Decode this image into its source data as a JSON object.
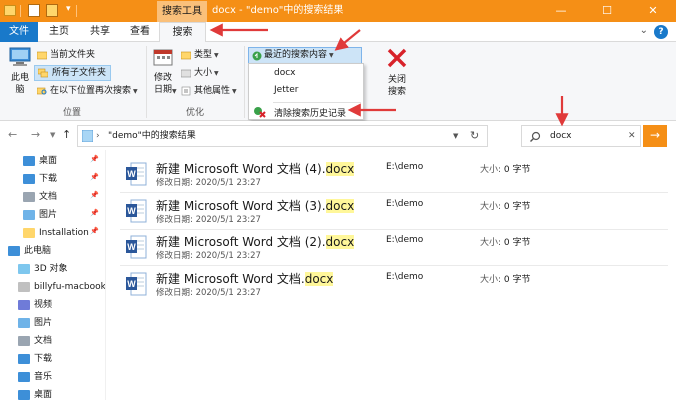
{
  "titlebar": {
    "context_tab_header": "搜索工具",
    "window_title": "docx - \"demo\"中的搜索结果",
    "minimize": "—",
    "maximize": "☐",
    "close": "✕"
  },
  "tabs": {
    "file": "文件",
    "home": "主页",
    "share": "共享",
    "view": "查看",
    "search": "搜索"
  },
  "ribbon": {
    "location_group": {
      "label": "位置",
      "this_pc": "此电\n脑",
      "current_folder": "当前文件夹",
      "all_subfolders": "所有子文件夹",
      "search_again_in": "在以下位置再次搜索"
    },
    "refine_group": {
      "label": "优化",
      "date_modified": "修改\n日期",
      "kind": "类型",
      "size": "大小",
      "other_properties": "其他属性"
    },
    "recent_searches": "最近的搜索内容",
    "recent_items": [
      "docx",
      "Jetter"
    ],
    "clear_history": "清除搜索历史记录",
    "close_search": "关闭\n搜索"
  },
  "address": {
    "path": "\"demo\"中的搜索结果"
  },
  "search": {
    "query": "docx",
    "clear": "✕",
    "go": "→"
  },
  "nav": {
    "items": [
      {
        "label": "桌面",
        "pinned": true
      },
      {
        "label": "下载",
        "pinned": true
      },
      {
        "label": "文档",
        "pinned": true
      },
      {
        "label": "图片",
        "pinned": true
      },
      {
        "label": "Installation",
        "pinned": true
      },
      {
        "label": "此电脑",
        "pinned": false
      },
      {
        "label": "3D 对象",
        "pinned": false
      },
      {
        "label": "billyfu-macbook",
        "pinned": false
      },
      {
        "label": "视频",
        "pinned": false
      },
      {
        "label": "图片",
        "pinned": false
      },
      {
        "label": "文档",
        "pinned": false
      },
      {
        "label": "下载",
        "pinned": false
      },
      {
        "label": "音乐",
        "pinned": false
      },
      {
        "label": "桌面",
        "pinned": false
      }
    ]
  },
  "files": [
    {
      "name_prefix": "新建 Microsoft Word 文档 (4).",
      "name_match": "docx",
      "date_label": "修改日期:",
      "date": "2020/5/1 23:27",
      "location": "E:\\demo",
      "size_label": "大小:",
      "size": "0 字节"
    },
    {
      "name_prefix": "新建 Microsoft Word 文档 (3).",
      "name_match": "docx",
      "date_label": "修改日期:",
      "date": "2020/5/1 23:27",
      "location": "E:\\demo",
      "size_label": "大小:",
      "size": "0 字节"
    },
    {
      "name_prefix": "新建 Microsoft Word 文档 (2).",
      "name_match": "docx",
      "date_label": "修改日期:",
      "date": "2020/5/1 23:27",
      "location": "E:\\demo",
      "size_label": "大小:",
      "size": "0 字节"
    },
    {
      "name_prefix": "新建 Microsoft Word 文档.",
      "name_match": "docx",
      "date_label": "修改日期:",
      "date": "2020/5/1 23:27",
      "location": "E:\\demo",
      "size_label": "大小:",
      "size": "0 字节"
    }
  ],
  "colors": {
    "accent_orange": "#f58f16",
    "file_tab_blue": "#1979ca",
    "highlight_yellow": "#fff79a",
    "annotation_red": "#e03a3a"
  }
}
